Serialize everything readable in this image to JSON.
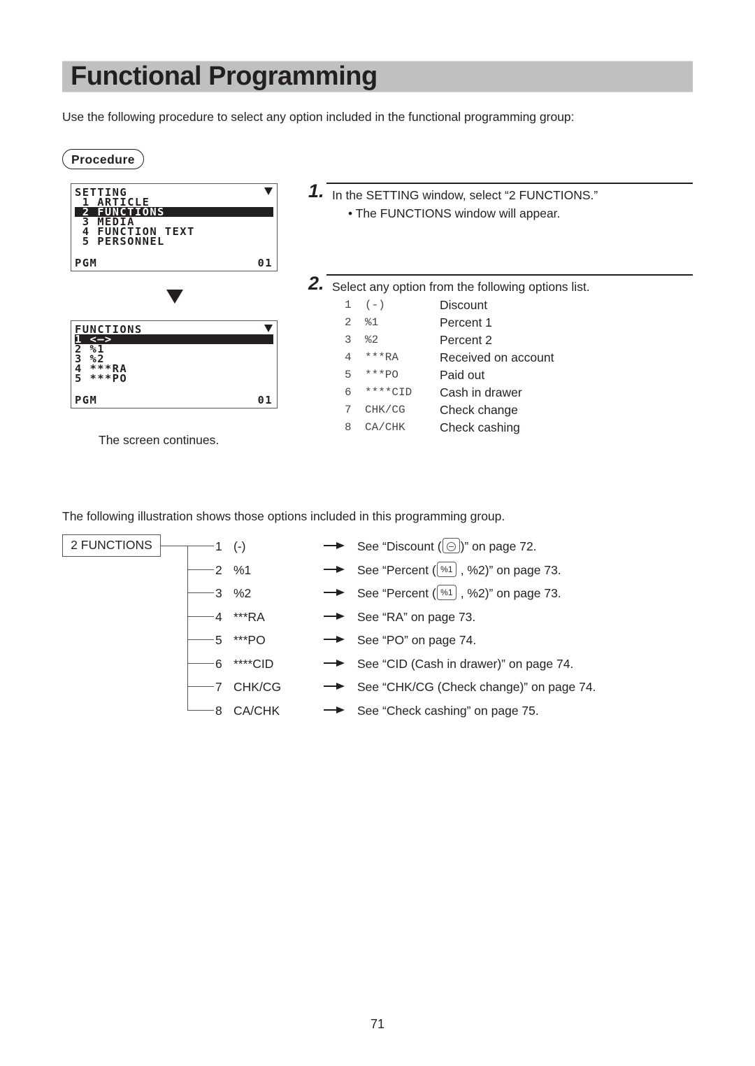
{
  "page": {
    "title": "Functional Programming",
    "intro": "Use the following procedure to select any option included in the functional programming group:",
    "procedure_label": "Procedure",
    "page_number": "71"
  },
  "lcd_setting": {
    "header": "SETTING",
    "rows": [
      {
        "text": " 1 ARTICLE",
        "selected": false
      },
      {
        "text": " 2 FUNCTIONS",
        "selected": true
      },
      {
        "text": " 3 MEDIA",
        "selected": false
      },
      {
        "text": " 4 FUNCTION TEXT",
        "selected": false
      },
      {
        "text": " 5 PERSONNEL",
        "selected": false
      }
    ],
    "footer_left": "PGM",
    "footer_right": "01",
    "scroll_icon": "triangle-down"
  },
  "lcd_functions": {
    "header": "FUNCTIONS",
    "rows": [
      {
        "text": "1 <—>",
        "selected": true
      },
      {
        "text": "2 %1",
        "selected": false
      },
      {
        "text": "3 %2",
        "selected": false
      },
      {
        "text": "4 ***RA",
        "selected": false
      },
      {
        "text": "5 ***PO",
        "selected": false
      }
    ],
    "footer_left": "PGM",
    "footer_right": "01",
    "scroll_icon": "triangle-down"
  },
  "screen_continues": "The screen continues.",
  "steps": [
    {
      "number": "1.",
      "text": "In the SETTING window, select “2 FUNCTIONS.”",
      "bullet": "• The FUNCTIONS window will appear."
    },
    {
      "number": "2.",
      "text": "Select any option from the following options list.",
      "options": [
        {
          "num": "1",
          "code": "(-)",
          "desc": "Discount"
        },
        {
          "num": "2",
          "code": "%1",
          "desc": "Percent 1"
        },
        {
          "num": "3",
          "code": "%2",
          "desc": "Percent 2"
        },
        {
          "num": "4",
          "code": "***RA",
          "desc": "Received on account"
        },
        {
          "num": "5",
          "code": "***PO",
          "desc": "Paid out"
        },
        {
          "num": "6",
          "code": "****CID",
          "desc": "Cash in drawer"
        },
        {
          "num": "7",
          "code": "CHK/CG",
          "desc": "Check change"
        },
        {
          "num": "8",
          "code": "CA/CHK",
          "desc": "Check cashing"
        }
      ]
    }
  ],
  "illustration": {
    "intro": "The following illustration shows those options included in this programming group.",
    "root": "2 FUNCTIONS",
    "items": [
      {
        "num": "1",
        "code": "(-)",
        "ref_pre": "See “Discount (",
        "key": "minus-key",
        "ref_post": ")” on page 72."
      },
      {
        "num": "2",
        "code": "%1",
        "ref_pre": "See “Percent (",
        "key": "%1",
        "ref_post": " , %2)” on page 73."
      },
      {
        "num": "3",
        "code": "%2",
        "ref_pre": "See “Percent (",
        "key": "%1",
        "ref_post": " , %2)” on page 73."
      },
      {
        "num": "4",
        "code": "***RA",
        "ref": "See “RA” on page 73."
      },
      {
        "num": "5",
        "code": "***PO",
        "ref": "See “PO” on page 74."
      },
      {
        "num": "6",
        "code": "****CID",
        "ref": "See “CID (Cash in drawer)” on page 74."
      },
      {
        "num": "7",
        "code": "CHK/CG",
        "ref": "See “CHK/CG (Check change)” on page 74."
      },
      {
        "num": "8",
        "code": "CA/CHK",
        "ref": "See “Check cashing” on page 75."
      }
    ]
  }
}
